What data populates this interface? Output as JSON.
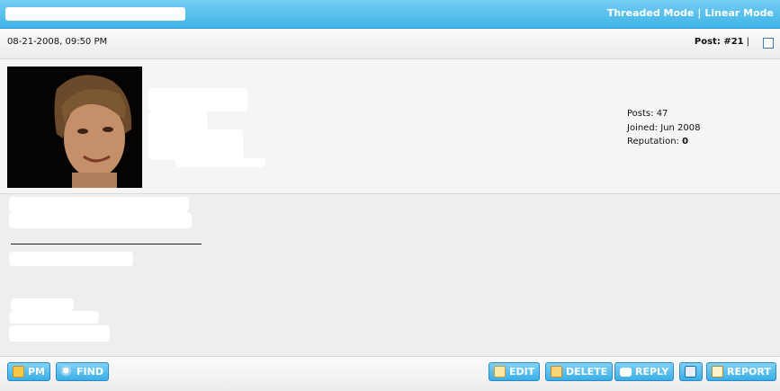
{
  "header": {
    "modes": [
      "Threaded Mode",
      "Linear Mode"
    ],
    "separator": "|"
  },
  "post": {
    "date": "08-21-2008, 09:50 PM",
    "number_label": "Post: #21",
    "number_sep": "|"
  },
  "user": {
    "stats": [
      {
        "label": "Posts:",
        "value": "47"
      },
      {
        "label": "Joined:",
        "value": "Jun 2008"
      },
      {
        "label": "Reputation:",
        "value": "0"
      }
    ]
  },
  "buttons": {
    "pm": "PM",
    "find": "FIND",
    "edit": "EDIT",
    "delete": "DELETE",
    "reply": "REPLY",
    "report": "REPORT"
  },
  "colors": {
    "accent": "#3fb3e6",
    "button": "#3aaee6"
  }
}
